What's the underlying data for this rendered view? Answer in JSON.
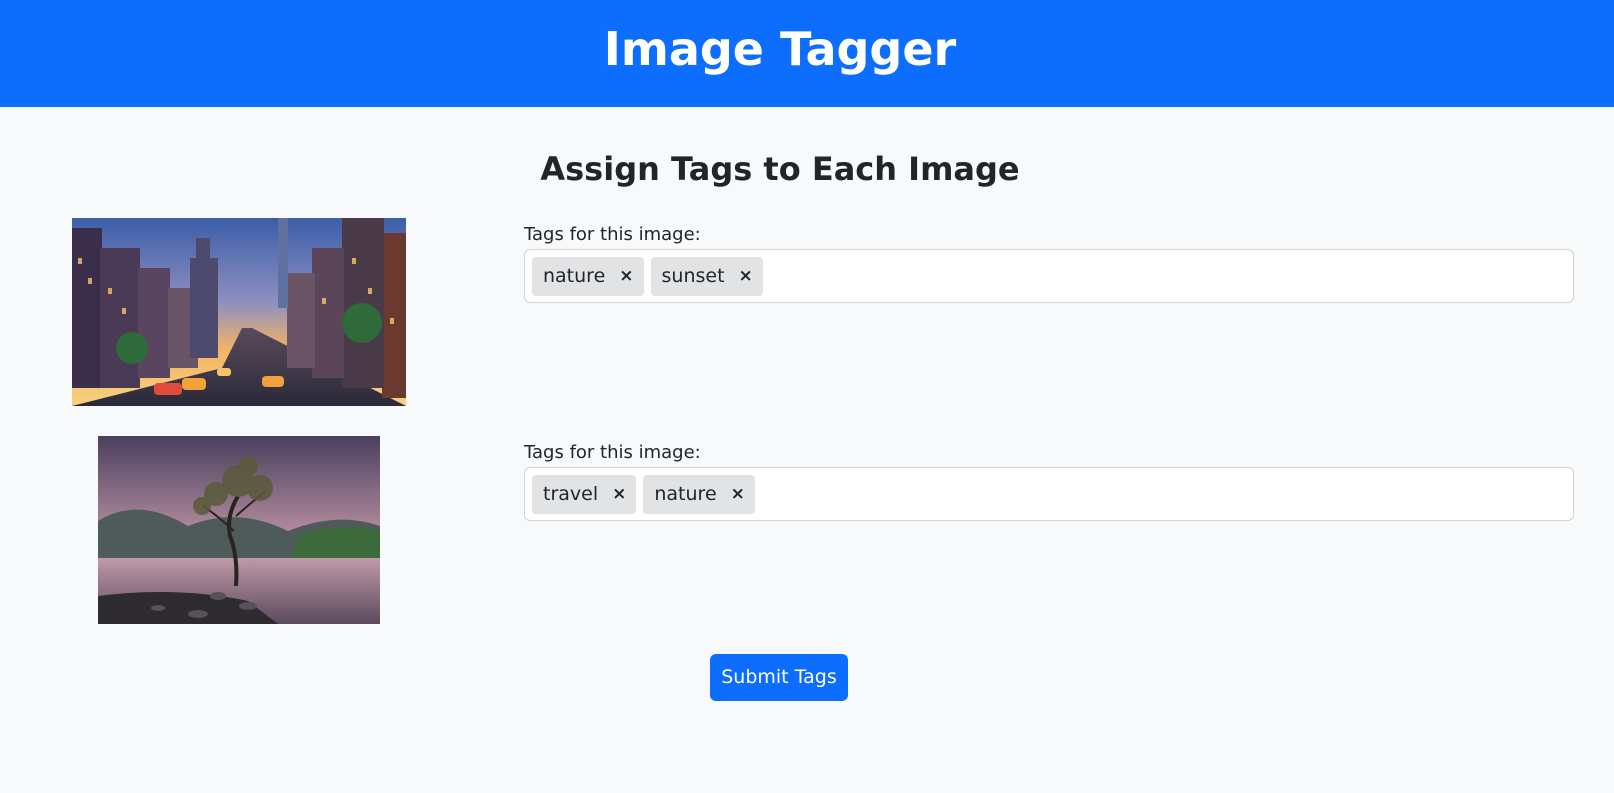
{
  "header": {
    "title": "Image Tagger"
  },
  "main": {
    "heading": "Assign Tags to Each Image",
    "images": [
      {
        "label": "Tags for this image:",
        "tags": [
          {
            "text": "nature",
            "remove": "×"
          },
          {
            "text": "sunset",
            "remove": "×"
          }
        ]
      },
      {
        "label": "Tags for this image:",
        "tags": [
          {
            "text": "travel",
            "remove": "×"
          },
          {
            "text": "nature",
            "remove": "×"
          }
        ]
      }
    ],
    "submit_label": "Submit Tags"
  },
  "colors": {
    "primary": "#0d6efd",
    "background": "#f8f9fa",
    "chip": "#e2e3e5"
  }
}
